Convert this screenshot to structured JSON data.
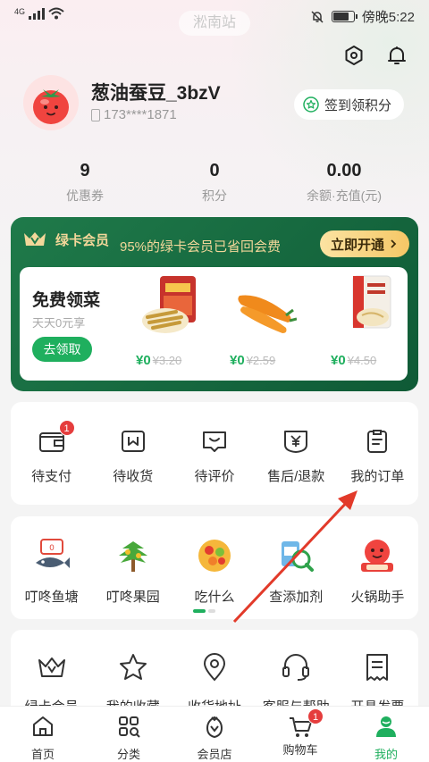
{
  "status_bar": {
    "network": "4G",
    "station": "淞南站",
    "time": "傍晚5:22"
  },
  "profile": {
    "username": "葱油蚕豆_3bzV",
    "phone": "173****1871",
    "checkin_label": "签到领积分"
  },
  "stats": [
    {
      "value": "9",
      "label": "优惠券"
    },
    {
      "value": "0",
      "label": "积分"
    },
    {
      "value": "0.00",
      "label": "余额·充值(元)"
    }
  ],
  "green_card": {
    "brand": "绿卡会员",
    "note": "95%的绿卡会员已省回会费",
    "open_btn": "立即开通",
    "free_title": "免费领菜",
    "free_sub": "天天0元享",
    "free_btn": "去领取",
    "products": [
      {
        "price": "¥0",
        "original": "¥3.20"
      },
      {
        "price": "¥0",
        "original": "¥2.59"
      },
      {
        "price": "¥0",
        "original": "¥4.50"
      }
    ]
  },
  "orders": [
    {
      "label": "待支付",
      "icon": "wallet-icon",
      "badge": "1"
    },
    {
      "label": "待收货",
      "icon": "box-icon"
    },
    {
      "label": "待评价",
      "icon": "comment-icon"
    },
    {
      "label": "售后/退款",
      "icon": "refund-icon"
    },
    {
      "label": "我的订单",
      "icon": "clipboard-icon"
    }
  ],
  "services": [
    {
      "label": "叮咚鱼塘",
      "icon": "fish-pond-icon"
    },
    {
      "label": "叮咚果园",
      "icon": "orchard-icon"
    },
    {
      "label": "吃什么",
      "icon": "food-bowl-icon"
    },
    {
      "label": "查添加剂",
      "icon": "additive-check-icon"
    },
    {
      "label": "火锅助手",
      "icon": "hotpot-icon"
    }
  ],
  "tools": [
    {
      "label": "绿卡会员",
      "icon": "crown-icon"
    },
    {
      "label": "我的收藏",
      "icon": "star-icon"
    },
    {
      "label": "收货地址",
      "icon": "location-icon"
    },
    {
      "label": "客服与帮助",
      "icon": "headset-icon"
    },
    {
      "label": "开具发票",
      "icon": "invoice-icon"
    }
  ],
  "tabbar": [
    {
      "label": "首页",
      "icon": "home-icon"
    },
    {
      "label": "分类",
      "icon": "category-icon"
    },
    {
      "label": "会员店",
      "icon": "member-store-icon"
    },
    {
      "label": "购物车",
      "icon": "cart-icon",
      "badge": "1"
    },
    {
      "label": "我的",
      "icon": "profile-icon",
      "active": true
    }
  ],
  "colors": {
    "brand_green": "#1faf5e",
    "card_green": "#16663f",
    "gold": "#f3d79a",
    "badge_red": "#e53d3d",
    "annotation_red": "#e23a2a"
  }
}
